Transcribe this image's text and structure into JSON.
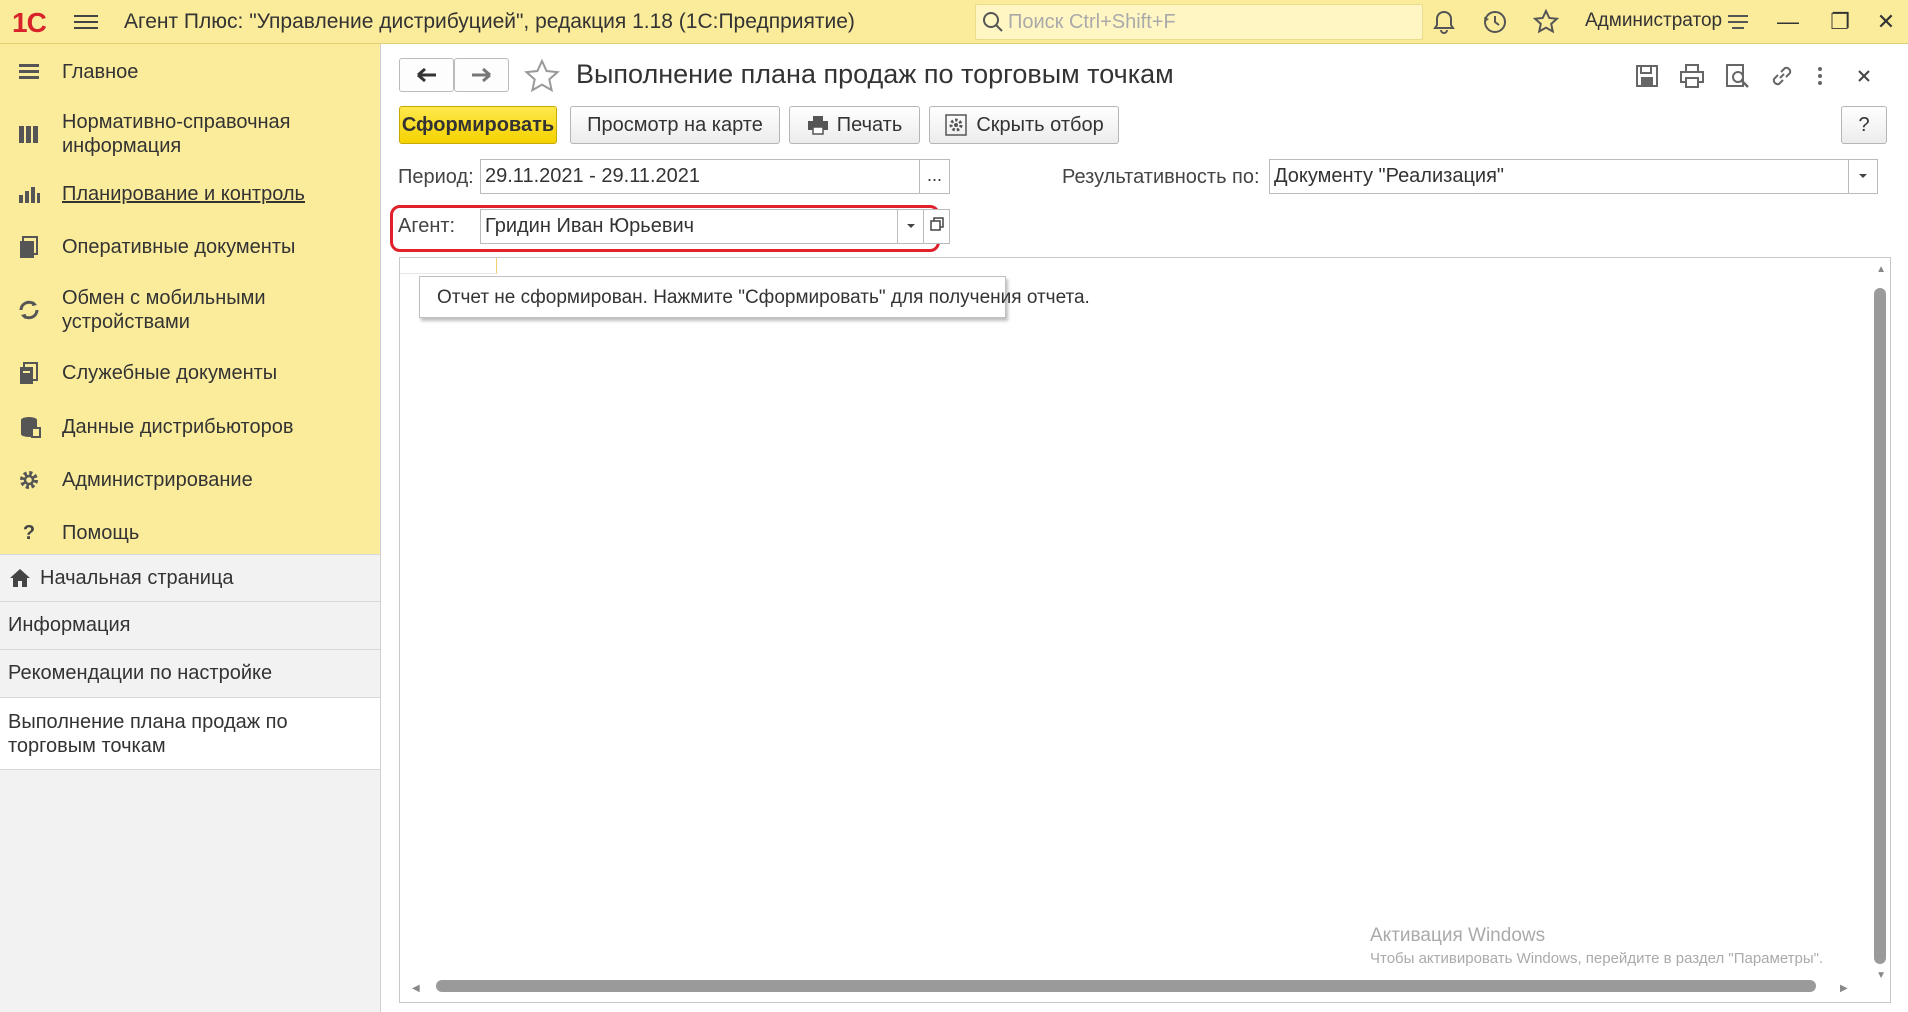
{
  "titlebar": {
    "logo": "1С",
    "title": "Агент Плюс: \"Управление дистрибуцией\", редакция 1.18  (1С:Предприятие)",
    "search_placeholder": "Поиск Ctrl+Shift+F",
    "user": "Администратор",
    "icons": [
      "bell-icon",
      "history-icon",
      "star-icon",
      "settings-lines-icon"
    ],
    "window_controls": [
      "minimize",
      "restore",
      "close"
    ]
  },
  "sidebar": {
    "sections": [
      {
        "label": "Главное",
        "icon": "list-icon"
      },
      {
        "label": "Нормативно-справочная информация",
        "icon": "books-icon"
      },
      {
        "label": "Планирование и контроль",
        "icon": "chart-icon",
        "active": true
      },
      {
        "label": "Оперативные документы",
        "icon": "documents-icon"
      },
      {
        "label": "Обмен с мобильными устройствами",
        "icon": "sync-icon"
      },
      {
        "label": "Служебные документы",
        "icon": "service-docs-icon"
      },
      {
        "label": "Данные дистрибьюторов",
        "icon": "database-icon"
      },
      {
        "label": "Администрирование",
        "icon": "gear-icon"
      },
      {
        "label": "Помощь",
        "icon": "question-icon"
      }
    ],
    "open_windows": [
      {
        "label": "Начальная страница",
        "icon": "home-icon"
      },
      {
        "label": "Информация"
      },
      {
        "label": "Рекомендации по настройке"
      },
      {
        "label": "Выполнение плана продаж по торговым точкам",
        "current": true
      }
    ]
  },
  "form": {
    "title": "Выполнение плана продаж по торговым точкам",
    "toolbar": {
      "generate": "Сформировать",
      "map_view": "Просмотр на карте",
      "print": "Печать",
      "hide_filter": "Скрыть отбор",
      "help": "?"
    },
    "period": {
      "label": "Период:",
      "value": "29.11.2021 - 29.11.2021",
      "button": "..."
    },
    "effectiveness": {
      "label": "Результативность по:",
      "value": "Документу \"Реализация\""
    },
    "agent": {
      "label": "Агент:",
      "value": "Гридин Иван Юрьевич"
    },
    "report_message": "Отчет не сформирован. Нажмите \"Сформировать\" для получения отчета."
  },
  "watermark": {
    "line1": "Активация Windows",
    "line2": "Чтобы активировать Windows, перейдите в раздел \"Параметры\"."
  },
  "colors": {
    "accent_yellow": "#fbec9c",
    "primary_button": "#f5d200",
    "highlight_frame": "#e0202a"
  }
}
